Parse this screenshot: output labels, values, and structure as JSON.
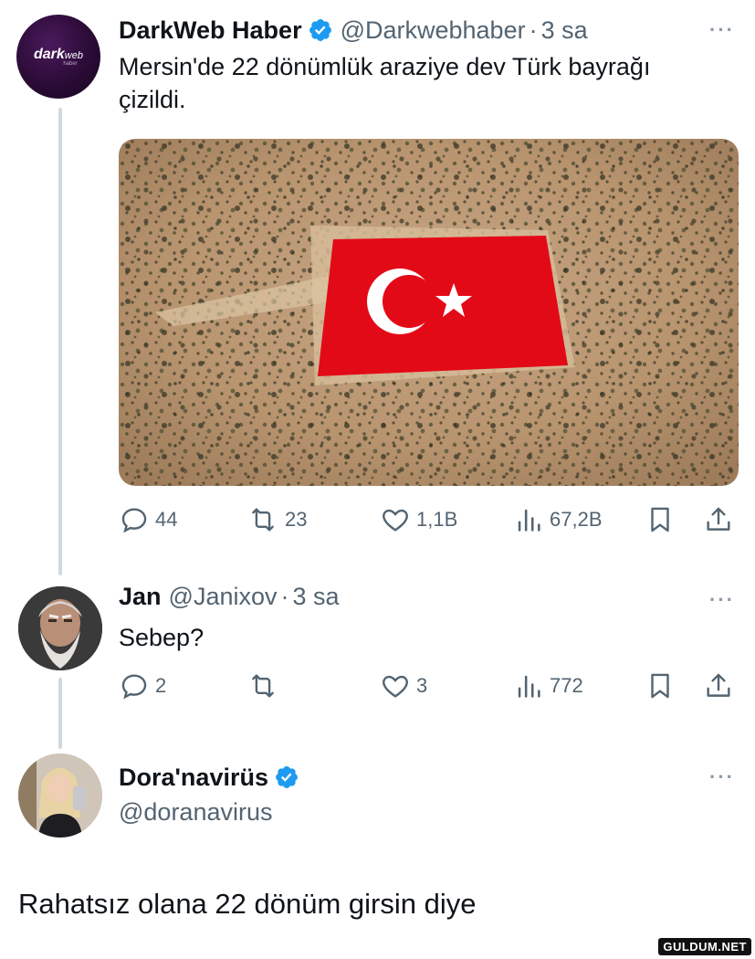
{
  "tweet1": {
    "avatar_text": "dark",
    "avatar_text2": "web",
    "avatar_sub": "haber",
    "name": "DarkWeb Haber",
    "handle": "@Darkwebhaber",
    "separator": "·",
    "time": "3 sa",
    "more": "···",
    "text_line1": "Mersin'de 22 dönümlük araziye dev Türk bayrağı",
    "text_line2": "çizildi.",
    "stats": {
      "replies": "44",
      "retweets": "23",
      "likes": "1,1B",
      "views": "67,2B"
    }
  },
  "tweet2": {
    "name": "Jan",
    "handle": "@Janixov",
    "separator": "·",
    "time": "3 sa",
    "more": "···",
    "text": "Sebep?",
    "stats": {
      "replies": "2",
      "retweets": "",
      "likes": "3",
      "views": "772"
    }
  },
  "tweet3": {
    "name": "Dora'navirüs",
    "handle": "@doranavirus",
    "more": "···",
    "text": "Rahatsız olana 22 dönüm girsin diye"
  },
  "watermark": "GULDUM.NET",
  "colors": {
    "verified": "#1d9bf0",
    "flag_red": "#e30a17",
    "thread_line": "#cfd9de",
    "secondary_text": "#536471"
  }
}
